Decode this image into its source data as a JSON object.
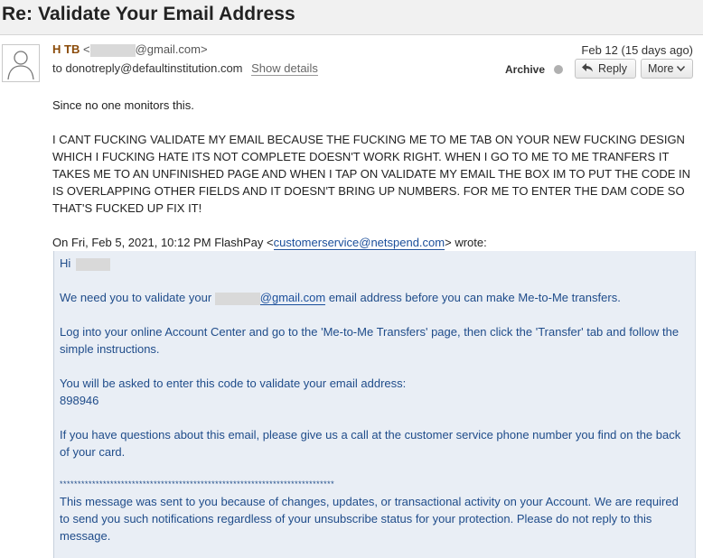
{
  "subject": "Re: Validate Your Email Address",
  "sender": {
    "name": "H TB",
    "email_open": "<",
    "email_domain": "@gmail.com>",
    "to_prefix": "to",
    "to_address": "donotreply@defaultinstitution.com",
    "show_details": "Show details"
  },
  "meta": {
    "date": "Feb 12 (15 days ago)",
    "archive": "Archive",
    "reply": "Reply",
    "more": "More"
  },
  "body": {
    "p1": "Since no one monitors this.",
    "p2": "I CANT FUCKING VALIDATE MY EMAIL BECAUSE THE FUCKING ME TO ME TAB ON YOUR NEW FUCKING DESIGN WHICH I FUCKING HATE ITS NOT COMPLETE DOESN'T WORK RIGHT. WHEN I GO TO ME TO ME TRANFERS IT TAKES ME TO AN UNFINISHED PAGE AND WHEN I TAP ON VALIDATE MY EMAIL THE BOX IM TO PUT THE CODE IN IS OVERLAPPING  OTHER FIELDS AND IT DOESN'T BRING UP NUMBERS. FOR ME TO ENTER THE DAM CODE SO THAT'S FUCKED UP FIX IT!",
    "wrote_prefix": "On Fri, Feb 5, 2021, 10:12 PM FlashPay <",
    "wrote_email": "customerservice@netspend.com",
    "wrote_suffix": "> wrote:"
  },
  "quote": {
    "greeting": "Hi",
    "validate_prefix": "We need you to validate your",
    "validate_email": "@gmail.com",
    "validate_suffix": " email address before you can make Me-to-Me transfers.",
    "login": "Log into your online Account Center and go to the 'Me-to-Me Transfers' page, then click the 'Transfer' tab and follow the simple instructions.",
    "code_intro": "You will be asked to enter this code to validate your email address:",
    "code": "898946",
    "questions": "If you have questions about this email, please give us a call at the customer service phone number you find on the back of your card.",
    "stars": "****************************************************************************",
    "notice": "This message was sent to you because of changes, updates, or transactional activity on your Account. We are required to send you such notifications regardless of your unsubscribe status for your protection. Please do not reply to this message."
  }
}
